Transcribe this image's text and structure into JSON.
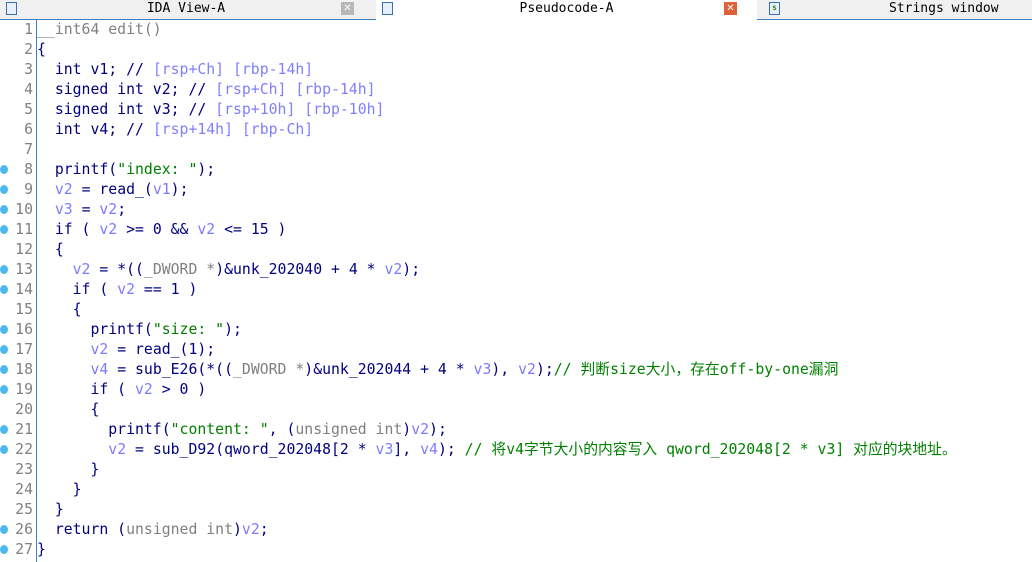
{
  "tabs": [
    {
      "label": "IDA View-A",
      "active": false,
      "icon": "document-icon"
    },
    {
      "label": "Pseudocode-A",
      "active": true,
      "icon": "document-icon"
    },
    {
      "label": "Strings window",
      "active": false,
      "icon": "strings-icon"
    }
  ],
  "colors": {
    "keyword": "#000080",
    "variable": "#7b7bff",
    "string": "#008000",
    "type_gray": "#808080",
    "comment": "#008000",
    "breakpoint": "#4cb8f0",
    "accent": "#3c7fc1"
  },
  "code": {
    "lines": [
      {
        "n": "1",
        "dot": false,
        "tokens": [
          {
            "c": "g",
            "t": "__int64 edit()"
          }
        ]
      },
      {
        "n": "2",
        "dot": false,
        "tokens": [
          {
            "c": "k",
            "t": "{"
          }
        ]
      },
      {
        "n": "3",
        "dot": false,
        "tokens": [
          {
            "c": "k",
            "t": "  int v1; //"
          },
          {
            "c": "m",
            "t": " [rsp+Ch] [rbp-14h]"
          }
        ]
      },
      {
        "n": "4",
        "dot": false,
        "tokens": [
          {
            "c": "k",
            "t": "  signed int v2; //"
          },
          {
            "c": "m",
            "t": " [rsp+Ch] [rbp-14h]"
          }
        ]
      },
      {
        "n": "5",
        "dot": false,
        "tokens": [
          {
            "c": "k",
            "t": "  signed int v3; //"
          },
          {
            "c": "m",
            "t": " [rsp+10h] [rbp-10h]"
          }
        ]
      },
      {
        "n": "6",
        "dot": false,
        "tokens": [
          {
            "c": "k",
            "t": "  int v4; //"
          },
          {
            "c": "m",
            "t": " [rsp+14h] [rbp-Ch]"
          }
        ]
      },
      {
        "n": "7",
        "dot": false,
        "tokens": []
      },
      {
        "n": "8",
        "dot": true,
        "tokens": [
          {
            "c": "k",
            "t": "  printf("
          },
          {
            "c": "s",
            "t": "\"index: \""
          },
          {
            "c": "k",
            "t": ");"
          }
        ]
      },
      {
        "n": "9",
        "dot": true,
        "tokens": [
          {
            "c": "k",
            "t": "  "
          },
          {
            "c": "v",
            "t": "v2"
          },
          {
            "c": "k",
            "t": " = read_("
          },
          {
            "c": "v",
            "t": "v1"
          },
          {
            "c": "k",
            "t": ");"
          }
        ]
      },
      {
        "n": "10",
        "dot": true,
        "tokens": [
          {
            "c": "k",
            "t": "  "
          },
          {
            "c": "v",
            "t": "v3"
          },
          {
            "c": "k",
            "t": " = "
          },
          {
            "c": "v",
            "t": "v2"
          },
          {
            "c": "k",
            "t": ";"
          }
        ]
      },
      {
        "n": "11",
        "dot": true,
        "tokens": [
          {
            "c": "k",
            "t": "  if ( "
          },
          {
            "c": "v",
            "t": "v2"
          },
          {
            "c": "k",
            "t": " >= 0 && "
          },
          {
            "c": "v",
            "t": "v2"
          },
          {
            "c": "k",
            "t": " <= 15 )"
          }
        ]
      },
      {
        "n": "12",
        "dot": false,
        "tokens": [
          {
            "c": "k",
            "t": "  {"
          }
        ]
      },
      {
        "n": "13",
        "dot": true,
        "tokens": [
          {
            "c": "k",
            "t": "    "
          },
          {
            "c": "v",
            "t": "v2"
          },
          {
            "c": "k",
            "t": " = *(("
          },
          {
            "c": "g",
            "t": "_DWORD *"
          },
          {
            "c": "k",
            "t": ")&unk_202040 + 4 * "
          },
          {
            "c": "v",
            "t": "v2"
          },
          {
            "c": "k",
            "t": ");"
          }
        ]
      },
      {
        "n": "14",
        "dot": true,
        "tokens": [
          {
            "c": "k",
            "t": "    if ( "
          },
          {
            "c": "v",
            "t": "v2"
          },
          {
            "c": "k",
            "t": " == 1 )"
          }
        ]
      },
      {
        "n": "15",
        "dot": false,
        "tokens": [
          {
            "c": "k",
            "t": "    {"
          }
        ]
      },
      {
        "n": "16",
        "dot": true,
        "tokens": [
          {
            "c": "k",
            "t": "      printf("
          },
          {
            "c": "s",
            "t": "\"size: \""
          },
          {
            "c": "k",
            "t": ");"
          }
        ]
      },
      {
        "n": "17",
        "dot": true,
        "tokens": [
          {
            "c": "k",
            "t": "      "
          },
          {
            "c": "v",
            "t": "v2"
          },
          {
            "c": "k",
            "t": " = read_(1);"
          }
        ]
      },
      {
        "n": "18",
        "dot": true,
        "tokens": [
          {
            "c": "k",
            "t": "      "
          },
          {
            "c": "v",
            "t": "v4"
          },
          {
            "c": "k",
            "t": " = sub_E26(*(("
          },
          {
            "c": "g",
            "t": "_DWORD *"
          },
          {
            "c": "k",
            "t": ")&unk_202044 + 4 * "
          },
          {
            "c": "v",
            "t": "v3"
          },
          {
            "c": "k",
            "t": "), "
          },
          {
            "c": "v",
            "t": "v2"
          },
          {
            "c": "k",
            "t": ");"
          },
          {
            "c": "c",
            "t": "// 判断size大小，存在off-by-one漏洞"
          }
        ]
      },
      {
        "n": "19",
        "dot": true,
        "tokens": [
          {
            "c": "k",
            "t": "      if ( "
          },
          {
            "c": "v",
            "t": "v2"
          },
          {
            "c": "k",
            "t": " > 0 )"
          }
        ]
      },
      {
        "n": "20",
        "dot": false,
        "tokens": [
          {
            "c": "k",
            "t": "      {"
          }
        ]
      },
      {
        "n": "21",
        "dot": true,
        "tokens": [
          {
            "c": "k",
            "t": "        printf("
          },
          {
            "c": "s",
            "t": "\"content: \""
          },
          {
            "c": "k",
            "t": ", ("
          },
          {
            "c": "g",
            "t": "unsigned int"
          },
          {
            "c": "k",
            "t": ")"
          },
          {
            "c": "v",
            "t": "v2"
          },
          {
            "c": "k",
            "t": ");"
          }
        ]
      },
      {
        "n": "22",
        "dot": true,
        "tokens": [
          {
            "c": "k",
            "t": "        "
          },
          {
            "c": "v",
            "t": "v2"
          },
          {
            "c": "k",
            "t": " = sub_D92(qword_202048[2 * "
          },
          {
            "c": "v",
            "t": "v3"
          },
          {
            "c": "k",
            "t": "], "
          },
          {
            "c": "v",
            "t": "v4"
          },
          {
            "c": "k",
            "t": "); "
          },
          {
            "c": "c",
            "t": "// 将v4字节大小的内容写入 qword_202048[2 * v3] 对应的块地址。"
          }
        ]
      },
      {
        "n": "23",
        "dot": false,
        "tokens": [
          {
            "c": "k",
            "t": "      }"
          }
        ]
      },
      {
        "n": "24",
        "dot": false,
        "tokens": [
          {
            "c": "k",
            "t": "    }"
          }
        ]
      },
      {
        "n": "25",
        "dot": false,
        "tokens": [
          {
            "c": "k",
            "t": "  }"
          }
        ]
      },
      {
        "n": "26",
        "dot": true,
        "tokens": [
          {
            "c": "k",
            "t": "  return ("
          },
          {
            "c": "g",
            "t": "unsigned int"
          },
          {
            "c": "k",
            "t": ")"
          },
          {
            "c": "v",
            "t": "v2"
          },
          {
            "c": "k",
            "t": ";"
          }
        ]
      },
      {
        "n": "27",
        "dot": true,
        "tokens": [
          {
            "c": "k",
            "t": "}"
          }
        ]
      }
    ]
  }
}
